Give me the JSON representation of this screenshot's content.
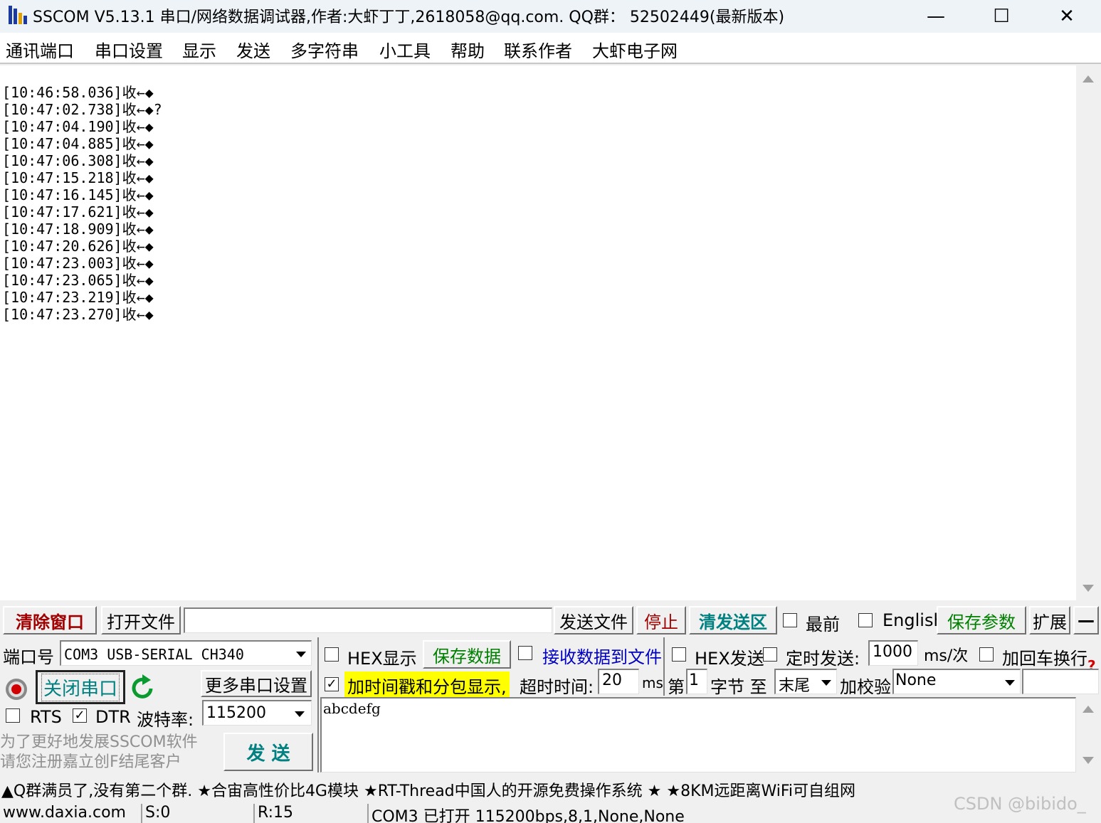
{
  "window": {
    "title": "SSCOM V5.13.1 串口/网络数据调试器,作者:大虾丁丁,2618058@qq.com. QQ群：  52502449(最新版本)",
    "minimize": "—",
    "maximize": "☐",
    "close": "✕"
  },
  "menu": [
    "通讯端口",
    "串口设置",
    "显示",
    "发送",
    "多字符串",
    "小工具",
    "帮助",
    "联系作者",
    "大虾电子网"
  ],
  "receive": {
    "lines": [
      "[10:46:58.036]收←◆",
      "[10:47:02.738]收←◆?",
      "[10:47:04.190]收←◆",
      "[10:47:04.885]收←◆",
      "[10:47:06.308]收←◆",
      "[10:47:15.218]收←◆",
      "[10:47:16.145]收←◆",
      "[10:47:17.621]收←◆",
      "[10:47:18.909]收←◆",
      "[10:47:20.626]收←◆",
      "[10:47:23.003]收←◆",
      "[10:47:23.065]收←◆",
      "[10:47:23.219]收←◆",
      "[10:47:23.270]收←◆"
    ]
  },
  "toolbar": {
    "clear_window": "清除窗口",
    "open_file": "打开文件",
    "file_path": "",
    "send_file": "发送文件",
    "stop": "停止",
    "clear_send": "清发送区",
    "topmost_label": "最前",
    "english_label": "English",
    "save_params": "保存参数",
    "expand": "扩展",
    "collapse": "—"
  },
  "port": {
    "port_label": "端口号",
    "port_value": "COM3 USB-SERIAL CH340",
    "close_port": "关闭串口",
    "more_settings": "更多串口设置",
    "rts_label": "RTS",
    "rts_checked": false,
    "dtr_label": "DTR",
    "dtr_checked": true,
    "baud_label": "波特率:",
    "baud_value": "115200",
    "promo_line1": "为了更好地发展SSCOM软件",
    "promo_line2": "请您注册嘉立创F结尾客户",
    "send": "发  送"
  },
  "options": {
    "hex_display": "HEX显示",
    "save_data": "保存数据",
    "recv_to_file": "接收数据到文件",
    "hex_send": "HEX发送",
    "timed_send": "定时发送:",
    "interval_value": "1000",
    "interval_unit": "ms/次",
    "add_crlf": "加回车换行",
    "timestamp": "加时间戳和分包显示,",
    "timestamp_checked": true,
    "timeout_label": "超时时间:",
    "timeout_value": "20",
    "timeout_unit": "ms",
    "byte_label_pre": "第",
    "byte_from": "1",
    "byte_label_mid": "字节 至",
    "byte_to": "末尾",
    "checksum_label": "加校验",
    "checksum_value": "None",
    "help_mark": "?"
  },
  "send_area": {
    "text": "abcdefg"
  },
  "marquee": "▲Q群满员了,没有第二个群. ★合宙高性价比4G模块 ★RT-Thread中国人的开源免费操作系统 ★ ★8KM远距离WiFi可自组网",
  "status": {
    "website": "www.daxia.com",
    "sent": "S:0",
    "received": "R:15",
    "port_state": "COM3 已打开  115200bps,8,1,None,None"
  },
  "watermark": "CSDN @bibido_",
  "colors": {
    "dark_red": "#a00000",
    "teal": "#008080",
    "green": "#008000",
    "highlight_yellow": "#ffff00",
    "link_blue": "#0000c0"
  }
}
